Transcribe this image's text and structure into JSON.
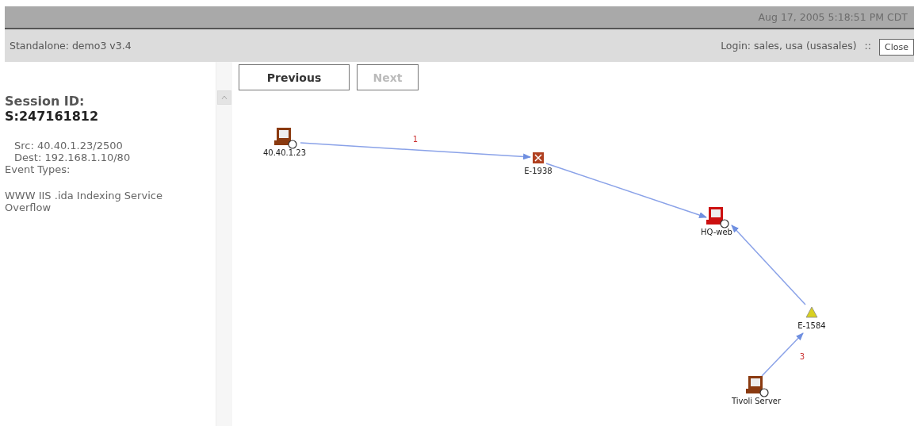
{
  "header": {
    "timestamp": "Aug 17, 2005 5:18:51 PM CDT"
  },
  "subheader": {
    "app": "Standalone: demo3 v3.4",
    "login": "Login: sales, usa (usasales)",
    "separator": "::",
    "close_button": "Close"
  },
  "session": {
    "title": "Session ID:",
    "id": "S:247161812",
    "src": "Src: 40.40.1.23/2500",
    "dest": "Dest: 192.168.1.10/80",
    "event_types_label": "Event Types:",
    "event_type": "WWW IIS .ida Indexing Service Overflow"
  },
  "navigation": [
    {
      "label": "Previous",
      "disabled": false
    },
    {
      "label": "Next",
      "disabled": true
    }
  ],
  "graph": {
    "nodes": [
      {
        "kind": "host",
        "label": "40.40.1.23",
        "color": "#8a3a10"
      },
      {
        "kind": "event",
        "label": "E-1938",
        "color": "#b04020"
      },
      {
        "kind": "host",
        "label": "HQ-web",
        "color": "#cc1010"
      },
      {
        "kind": "warning",
        "label": "E-1584",
        "color": "#d8d020"
      },
      {
        "kind": "host",
        "label": "Tivoli Server",
        "color": "#8a3a10"
      }
    ],
    "edge_labels": [
      "1",
      "3"
    ]
  }
}
